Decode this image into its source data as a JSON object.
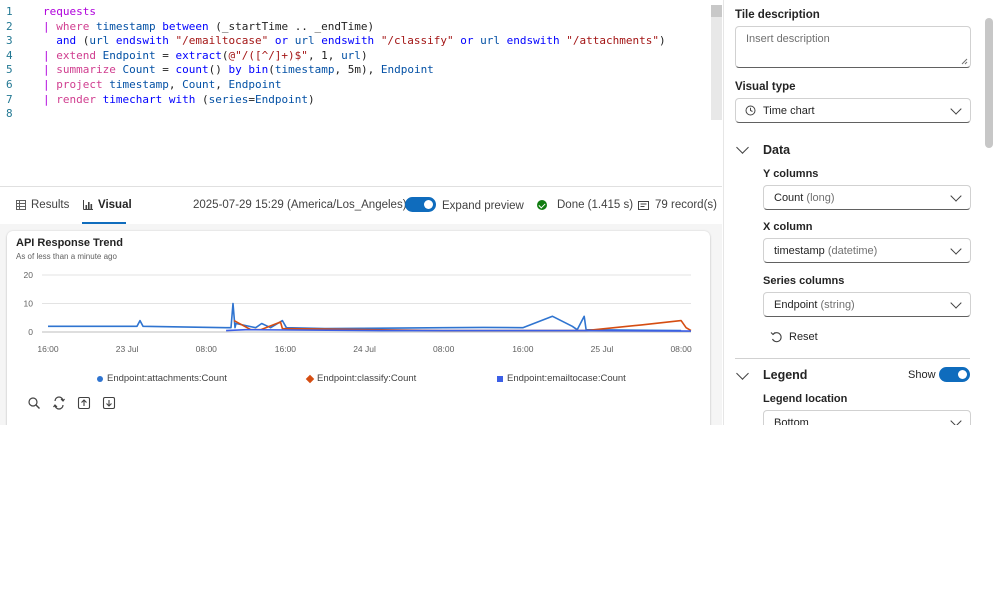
{
  "editor": {
    "line_numbers": [
      "1",
      "2",
      "3",
      "4",
      "5",
      "6",
      "7",
      "8"
    ],
    "lines": [
      [
        {
          "t": "requests",
          "c": "tbl"
        }
      ],
      [
        {
          "t": "| ",
          "c": "pipe"
        },
        {
          "t": "where ",
          "c": "op"
        },
        {
          "t": "timestamp ",
          "c": "id"
        },
        {
          "t": "between ",
          "c": "kw"
        },
        {
          "t": "(_startTime .. _endTime)",
          "c": "code-text"
        }
      ],
      [
        {
          "t": "  and ",
          "c": "kw"
        },
        {
          "t": "(",
          "c": "code-text"
        },
        {
          "t": "url ",
          "c": "id"
        },
        {
          "t": "endswith ",
          "c": "kw"
        },
        {
          "t": "\"/emailtocase\" ",
          "c": "str"
        },
        {
          "t": "or ",
          "c": "kw"
        },
        {
          "t": "url ",
          "c": "id"
        },
        {
          "t": "endswith ",
          "c": "kw"
        },
        {
          "t": "\"/classify\" ",
          "c": "str"
        },
        {
          "t": "or ",
          "c": "kw"
        },
        {
          "t": "url ",
          "c": "id"
        },
        {
          "t": "endswith ",
          "c": "kw"
        },
        {
          "t": "\"/attachments\"",
          "c": "str"
        },
        {
          "t": ")",
          "c": "code-text"
        }
      ],
      [
        {
          "t": "| ",
          "c": "pipe"
        },
        {
          "t": "extend ",
          "c": "op"
        },
        {
          "t": "Endpoint ",
          "c": "id"
        },
        {
          "t": "= ",
          "c": "code-text"
        },
        {
          "t": "extract",
          "c": "kw"
        },
        {
          "t": "(",
          "c": "code-text"
        },
        {
          "t": "@\"/([^/]+)$\"",
          "c": "str"
        },
        {
          "t": ", 1, ",
          "c": "code-text"
        },
        {
          "t": "url",
          "c": "id"
        },
        {
          "t": ")",
          "c": "code-text"
        }
      ],
      [
        {
          "t": "| ",
          "c": "pipe"
        },
        {
          "t": "summarize ",
          "c": "op"
        },
        {
          "t": "Count ",
          "c": "id"
        },
        {
          "t": "= ",
          "c": "code-text"
        },
        {
          "t": "count",
          "c": "kw"
        },
        {
          "t": "() ",
          "c": "code-text"
        },
        {
          "t": "by ",
          "c": "kw"
        },
        {
          "t": "bin",
          "c": "kw"
        },
        {
          "t": "(",
          "c": "code-text"
        },
        {
          "t": "timestamp",
          "c": "id"
        },
        {
          "t": ", 5m), ",
          "c": "code-text"
        },
        {
          "t": "Endpoint",
          "c": "id"
        }
      ],
      [
        {
          "t": "| ",
          "c": "pipe"
        },
        {
          "t": "project ",
          "c": "op"
        },
        {
          "t": "timestamp",
          "c": "id"
        },
        {
          "t": ", ",
          "c": "code-text"
        },
        {
          "t": "Count",
          "c": "id"
        },
        {
          "t": ", ",
          "c": "code-text"
        },
        {
          "t": "Endpoint",
          "c": "id"
        }
      ],
      [
        {
          "t": "| ",
          "c": "pipe"
        },
        {
          "t": "render ",
          "c": "op"
        },
        {
          "t": "timechart ",
          "c": "kw"
        },
        {
          "t": "with ",
          "c": "kw"
        },
        {
          "t": "(",
          "c": "code-text"
        },
        {
          "t": "series",
          "c": "id"
        },
        {
          "t": "=",
          "c": "code-text"
        },
        {
          "t": "Endpoint",
          "c": "id"
        },
        {
          "t": ")",
          "c": "code-text"
        }
      ],
      []
    ]
  },
  "toolbar": {
    "results_label": "Results",
    "visual_label": "Visual",
    "timestamp": "2025-07-29 15:29 (America/Los_Angeles)",
    "expand_label": "Expand preview",
    "done_label": "Done (1.415 s)",
    "records_label": "79 record(s)",
    "accent": "#0f6cbd",
    "done_color": "#107c10"
  },
  "chart_title": "API Response Trend",
  "chart_subtitle": "As of less than a minute ago",
  "chart_data": {
    "type": "line",
    "ylim": [
      0,
      20
    ],
    "yticks": [
      "0",
      "10",
      "20"
    ],
    "x_ticks": [
      "16:00",
      "23 Jul",
      "08:00",
      "16:00",
      "24 Jul",
      "08:00",
      "16:00",
      "25 Jul",
      "08:00"
    ],
    "x_tick_hours": [
      16,
      24,
      32,
      40,
      48,
      56,
      64,
      72,
      80
    ],
    "xlim_hours": [
      16,
      81
    ],
    "legend_position": "bottom",
    "series": [
      {
        "name": "Endpoint:attachments:Count",
        "color": "#2f74d0",
        "marker": "circle",
        "points": [
          [
            16,
            2
          ],
          [
            25,
            2
          ],
          [
            25.3,
            4
          ],
          [
            25.6,
            2
          ],
          [
            34,
            1.5
          ],
          [
            34.5,
            1.5
          ],
          [
            34.7,
            10
          ],
          [
            34.9,
            1.5
          ],
          [
            35,
            3
          ],
          [
            37,
            1.5
          ],
          [
            37.6,
            3
          ],
          [
            38.5,
            1.5
          ],
          [
            39.7,
            4
          ],
          [
            40.1,
            1.5
          ],
          [
            44,
            1.2
          ],
          [
            56,
            1.5
          ],
          [
            60,
            1.6
          ],
          [
            64,
            1.5
          ],
          [
            67,
            5.5
          ],
          [
            69,
            2
          ],
          [
            69.5,
            0.8
          ],
          [
            70.2,
            5.5
          ],
          [
            70.4,
            0.8
          ],
          [
            80,
            0.5
          ]
        ]
      },
      {
        "name": "Endpoint:classify:Count",
        "color": "#d54d12",
        "marker": "diamond",
        "points": [
          [
            34.8,
            4
          ],
          [
            36.5,
            0.8
          ],
          [
            37.5,
            0.8
          ],
          [
            39.5,
            3.5
          ],
          [
            39.7,
            1.2
          ],
          [
            56,
            0.5
          ],
          [
            70.4,
            0.5
          ],
          [
            76,
            2.5
          ],
          [
            80,
            4
          ],
          [
            80.5,
            1.5
          ],
          [
            81,
            0.5
          ]
        ]
      },
      {
        "name": "Endpoint:emailtocase:Count",
        "color": "#3c5fe6",
        "marker": "square",
        "points": [
          [
            34,
            0.5
          ],
          [
            36,
            0.8
          ],
          [
            50,
            0.5
          ],
          [
            70,
            0.5
          ],
          [
            81,
            0.3
          ]
        ]
      }
    ]
  },
  "right_pane": {
    "tile_description_label": "Tile description",
    "tile_description_placeholder": "Insert description",
    "visual_type_label": "Visual type",
    "visual_type_value": "Time chart",
    "data_section": "Data",
    "y_columns_label": "Y columns",
    "y_columns_value": "Count",
    "y_columns_type": "(long)",
    "x_column_label": "X column",
    "x_column_value": "timestamp",
    "x_column_type": "(datetime)",
    "series_columns_label": "Series columns",
    "series_columns_value": "Endpoint",
    "series_columns_type": "(string)",
    "reset_label": "Reset",
    "legend_section": "Legend",
    "legend_show_label": "Show",
    "legend_location_label": "Legend location",
    "legend_location_value": "Bottom"
  }
}
